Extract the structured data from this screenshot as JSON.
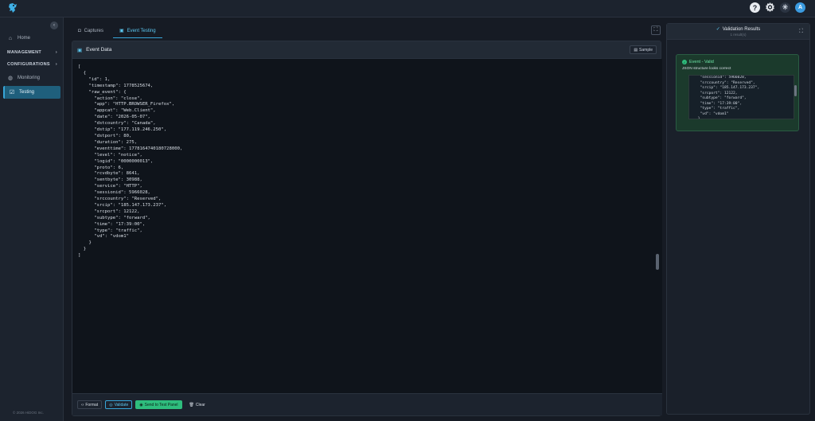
{
  "sidebar": {
    "items": [
      {
        "label": "Home",
        "icon": "home-icon"
      },
      {
        "label": "MANAGEMENT",
        "icon": "chevron-right-icon"
      },
      {
        "label": "CONFIGURATIONS",
        "icon": "chevron-right-icon"
      },
      {
        "label": "Monitoring",
        "icon": "monitoring-icon"
      },
      {
        "label": "Testing",
        "icon": "testing-icon"
      }
    ],
    "footer": "© 2026 HiDOG Inc."
  },
  "tabs": [
    {
      "label": "Captures"
    },
    {
      "label": "Event Testing"
    }
  ],
  "event_panel": {
    "title": "Event Data",
    "sample_label": "Sample",
    "code": "[\n  {\n    \"id\": 1,\n    \"timestamp\": 1778525674,\n    \"raw_event\": {\n      \"action\": \"close\",\n      \"app\": \"HTTP.BROWSER_Firefox\",\n      \"appcat\": \"Web.Client\",\n      \"date\": \"2026-05-07\",\n      \"dstcountry\": \"Canada\",\n      \"dstip\": \"177.119.246.250\",\n      \"dstport\": 80,\n      \"duration\": 275,\n      \"eventtime\": 1778164740180728000,\n      \"level\": \"notice\",\n      \"logid\": \"0000000013\",\n      \"proto\": 6,\n      \"rcvdbyte\": 8641,\n      \"sentbyte\": 30988,\n      \"service\": \"HTTP\",\n      \"sessionid\": 5966028,\n      \"srccountry\": \"Reserved\",\n      \"srcip\": \"185.147.173.237\",\n      \"srcport\": 12122,\n      \"subtype\": \"forward\",\n      \"time\": \"17:39:00\",\n      \"type\": \"traffic\",\n      \"vd\": \"vdom1\"\n    }\n  }\n]",
    "buttons": {
      "format": "Format",
      "validate": "Validate",
      "send": "Send to Test Panel",
      "clear": "Clear"
    }
  },
  "validation": {
    "title": "Validation Results",
    "subtitle": "1 result(s)",
    "card_title": "Event - Valid",
    "card_message": "JSON structure looks correct",
    "card_code": "  \"sessionid\": 5966028,\n  \"srccountry\": \"Reserved\",\n  \"srcip\": \"185.147.173.237\",\n  \"srcport\": 12122,\n  \"subtype\": \"forward\",\n  \"time\": \"17:39:00\",\n  \"type\": \"traffic\",\n  \"vd\": \"vdom1\"\n }"
  },
  "header": {
    "avatar_initial": "A"
  },
  "colors": {
    "accent": "#38a5d8",
    "success": "#2ebd7d",
    "background": "#161b24"
  }
}
